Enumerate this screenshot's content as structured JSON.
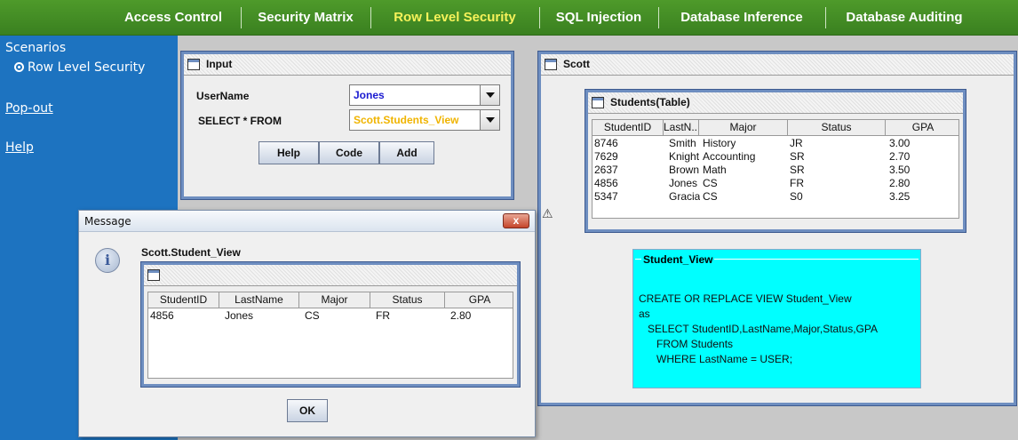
{
  "nav": {
    "tabs": [
      {
        "label": "Access Control"
      },
      {
        "label": "Security Matrix"
      },
      {
        "label": "Row Level Security"
      },
      {
        "label": "SQL Injection"
      },
      {
        "label": "Database Inference"
      },
      {
        "label": "Database Auditing"
      }
    ],
    "active": "Row Level Security"
  },
  "sidebar": {
    "title": "Scenarios",
    "scenario": "Row Level Security",
    "popout": "Pop-out",
    "help": "Help"
  },
  "input_frame": {
    "title": "Input",
    "username_label": "UserName",
    "username_value": "Jones",
    "select_label": "SELECT * FROM",
    "select_value": "Scott.Students_View",
    "buttons": {
      "help": "Help",
      "code": "Code",
      "add": "Add"
    }
  },
  "scott_frame": {
    "title": "Scott",
    "students_table": {
      "title": "Students(Table)",
      "columns": [
        "StudentID",
        "LastN...",
        "Major",
        "Status",
        "GPA"
      ],
      "rows": [
        [
          "8746",
          "Smith",
          "History",
          "JR",
          "3.00"
        ],
        [
          "7629",
          "Knight",
          "Accounting",
          "SR",
          "2.70"
        ],
        [
          "2637",
          "Brown",
          "Math",
          "SR",
          "3.50"
        ],
        [
          "4856",
          "Jones",
          "CS",
          "FR",
          "2.80"
        ],
        [
          "5347",
          "Gracia",
          "CS",
          "S0",
          "3.25"
        ]
      ]
    },
    "view": {
      "title": "Student_View",
      "sql": [
        "CREATE OR REPLACE VIEW Student_View",
        "as",
        "SELECT StudentID,LastName,Major,Status,GPA",
        "FROM Students",
        "WHERE LastName = USER;"
      ]
    }
  },
  "dialog": {
    "title": "Message",
    "close": "x",
    "heading": "Scott.Student_View",
    "columns": [
      "StudentID",
      "LastName",
      "Major",
      "Status",
      "GPA"
    ],
    "rows": [
      [
        "4856",
        "Jones",
        "CS",
        "FR",
        "2.80"
      ]
    ],
    "ok": "OK"
  },
  "colors": {
    "nav_bg": "#3f8a24",
    "nav_active_text": "#f6f25a",
    "sidebar_bg": "#1d73c0",
    "view_bg": "#00ffff",
    "username_color": "#1a1ad0",
    "select_color": "#f0b400"
  }
}
